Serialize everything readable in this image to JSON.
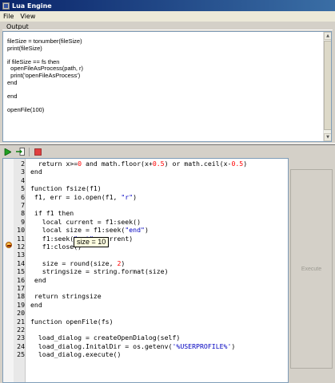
{
  "window": {
    "title": "Lua Engine"
  },
  "menu": {
    "file": "File",
    "view": "View"
  },
  "output": {
    "label": "Output",
    "lines": [
      "fileSize = tonumber(fileSize)",
      "print(fileSize)",
      "",
      "if fileSize == fs then",
      "  openFileAsProcess(path, r)",
      "  print('openFileAsProcess')",
      "end",
      "",
      "end",
      "",
      "openFile(100)"
    ]
  },
  "toolbar": {
    "run": "play-icon",
    "step": "step-into-icon",
    "stop": "stop-icon"
  },
  "editor": {
    "breakpoint_line": "11",
    "tooltip": "size = 10",
    "lines": [
      {
        "n": "2",
        "code": "  return x>=0 and math.floor(x+0.5) or math.ceil(x-0.5)"
      },
      {
        "n": "3",
        "code": "end"
      },
      {
        "n": "4",
        "code": ""
      },
      {
        "n": "5",
        "code": "function fsize(f1)"
      },
      {
        "n": "6",
        "code": " f1, err = io.open(f1, \"r\")"
      },
      {
        "n": "7",
        "code": ""
      },
      {
        "n": "8",
        "code": " if f1 then"
      },
      {
        "n": "9",
        "code": "   local current = f1:seek()"
      },
      {
        "n": "10",
        "code": "   local size = f1:seek(\"end\")"
      },
      {
        "n": "11",
        "code": "   f1:seek(\"set\", current)"
      },
      {
        "n": "12",
        "code": "   f1:close()"
      },
      {
        "n": "13",
        "code": ""
      },
      {
        "n": "14",
        "code": "   size = round(size, 2)"
      },
      {
        "n": "15",
        "code": "   stringsize = string.format(size)"
      },
      {
        "n": "16",
        "code": " end"
      },
      {
        "n": "17",
        "code": ""
      },
      {
        "n": "18",
        "code": " return stringsize"
      },
      {
        "n": "19",
        "code": "end"
      },
      {
        "n": "20",
        "code": ""
      },
      {
        "n": "21",
        "code": "function openFile(fs)"
      },
      {
        "n": "22",
        "code": ""
      },
      {
        "n": "23",
        "code": "  load_dialog = createOpenDialog(self)"
      },
      {
        "n": "24",
        "code": "  load_dialog.InitalDir = os.getenv('%USERPROFILE%')"
      },
      {
        "n": "25",
        "code": "  load_dialog.execute()"
      }
    ]
  },
  "execute": {
    "label": "Execute"
  },
  "colors": {
    "number": "#ff0000",
    "string": "#0000c0",
    "tooltip_bg": "#ffffe1",
    "title_bar": "#0a246a"
  }
}
